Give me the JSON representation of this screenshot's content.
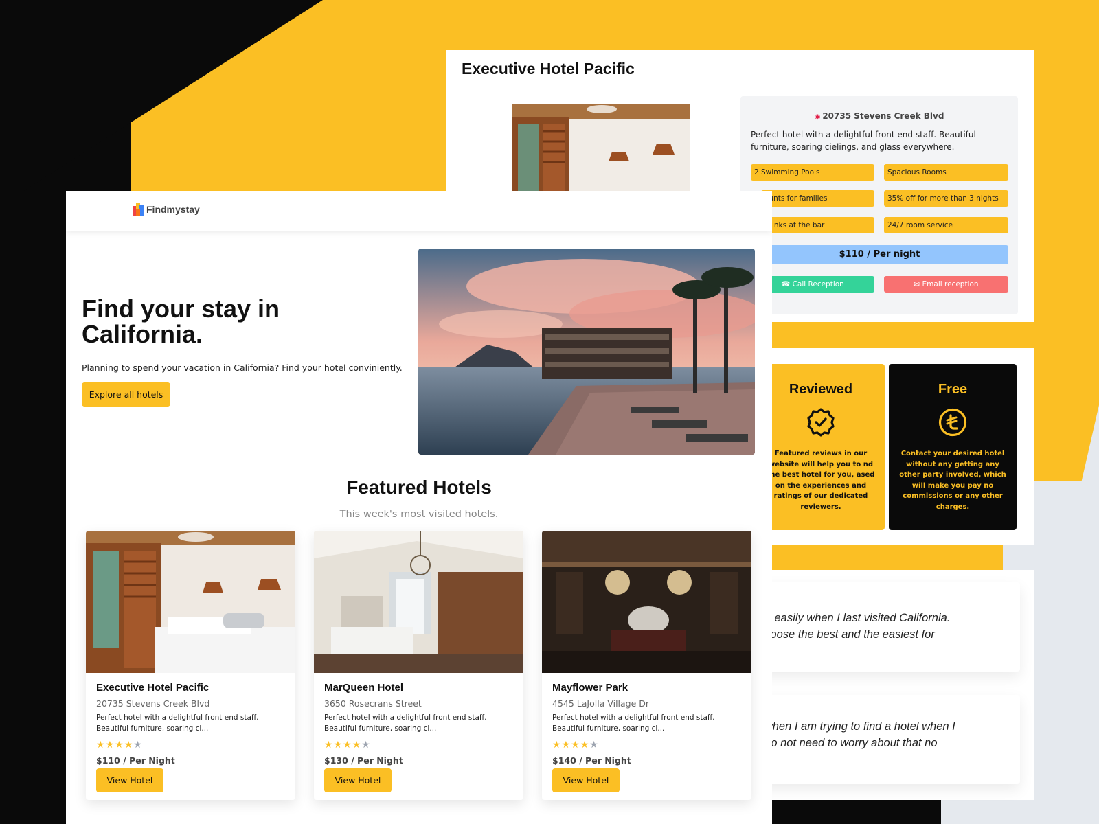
{
  "brand": {
    "name": "Findmystay",
    "accent": "#fbbf24",
    "dark": "#0a0a0a"
  },
  "detail": {
    "title": "Executive Hotel Pacific",
    "address": "20735 Stevens Creek Blvd",
    "description": "Perfect hotel with a delightful front end staff. Beautiful furniture, soaring cielings, and glass everywhere.",
    "amenities": [
      "2 Swimming Pools",
      "Spacious Rooms",
      "ounts for families",
      "35% off for more than 3 nights",
      "drinks at the bar",
      "24/7 room service"
    ],
    "price": "$110 / Per night",
    "call_label": "Call Reception",
    "email_label": "Email reception",
    "call_color": "#34d399",
    "email_color": "#f87171",
    "price_color": "#93c5fd"
  },
  "features": [
    {
      "title": "Reviewed",
      "icon": "badge-check-icon",
      "text": "Featured reviews in our website will help you to nd the best hotel for you, ased on the experiences and ratings of our dedicated reviewers."
    },
    {
      "title": "Free",
      "icon": "currency-badge-icon",
      "text": "Contact your desired hotel without any getting any other party involved, which will make you pay no commissions or any other charges."
    }
  ],
  "testimonials": [
    {
      "line1": "ery easily when I last visited California.",
      "line2": "choose the best and the easiest for"
    },
    {
      "line1": "y when I am trying to find a hotel when I",
      "line2": "I do not need to worry about that no"
    }
  ],
  "hero": {
    "title": "Find your stay in California.",
    "subtitle": "Planning to spend your vacation in California? Find your hotel conviniently.",
    "button": "Explore all hotels"
  },
  "featured": {
    "title": "Featured Hotels",
    "subtitle": "This week's most visited hotels.",
    "hotels": [
      {
        "name": "Executive Hotel Pacific",
        "address": "20735 Stevens Creek Blvd",
        "description": "Perfect hotel with a delightful front end staff. Beautiful furniture, soaring ci...",
        "rating": 4,
        "price": "$110 / Per Night",
        "button": "View Hotel"
      },
      {
        "name": "MarQueen Hotel",
        "address": "3650 Rosecrans Street",
        "description": "Perfect hotel with a delightful front end staff. Beautiful furniture, soaring ci...",
        "rating": 4,
        "price": "$130 / Per Night",
        "button": "View Hotel"
      },
      {
        "name": "Mayflower Park",
        "address": "4545 LaJolla Village Dr",
        "description": "Perfect hotel with a delightful front end staff. Beautiful furniture, soaring ci...",
        "rating": 4,
        "price": "$140 / Per Night",
        "button": "View Hotel"
      }
    ]
  }
}
